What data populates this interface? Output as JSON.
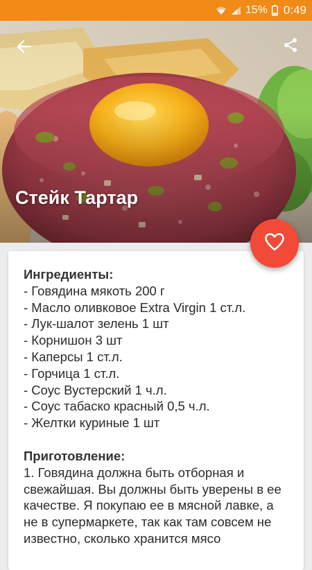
{
  "status_bar": {
    "battery_percent": "15%",
    "time": "0:49",
    "color": "#f28a17"
  },
  "hero": {
    "title": "Стейк Тартар"
  },
  "icons": {
    "back": "arrow-back-icon",
    "share": "share-icon",
    "favorite": "heart-outline-icon",
    "wifi": "wifi-icon",
    "signal": "signal-icon",
    "battery": "battery-icon"
  },
  "fab": {
    "color": "#f24a39"
  },
  "recipe": {
    "ingredients_heading": "Ингредиенты:",
    "ingredients": [
      "- Говядина мякоть 200 г",
      "- Масло оливковое Extra Virgin 1 ст.л.",
      "- Лук-шалот зелень 1 шт",
      "- Корнишон 3 шт",
      "- Каперсы 1 ст.л.",
      "- Горчица 1 ст.л.",
      "- Соус Вустерский 1 ч.л.",
      "- Соус табаско красный 0,5 ч.л.",
      "- Желтки куриные 1 шт"
    ],
    "preparation_heading": "Приготовление:",
    "preparation_text": "1. Говядина должна быть отборная и свежайшая. Вы должны быть уверены в ее качестве. Я покупаю ее в мясной лавке, а не в супермаркете, так как там совсем не известно, сколько хранится мясо"
  }
}
